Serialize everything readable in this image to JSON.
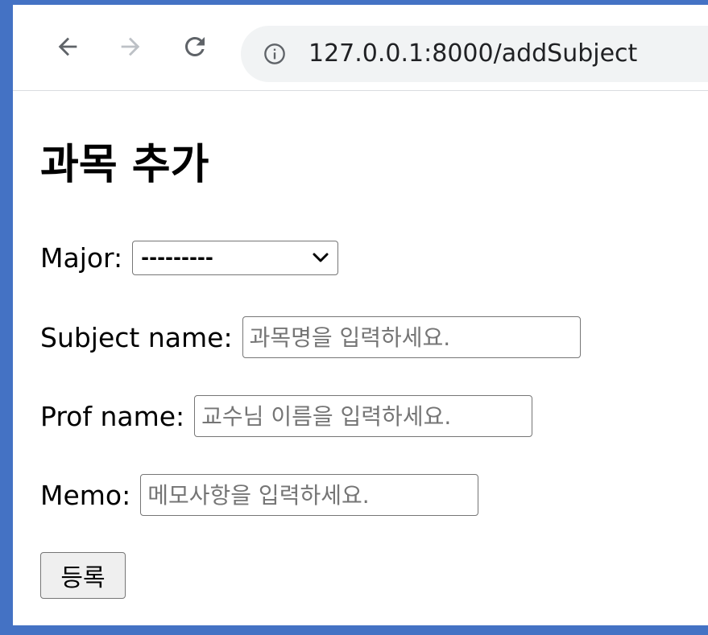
{
  "browser": {
    "url": "127.0.0.1:8000/addSubject",
    "icons": {
      "back": "arrow-left-icon",
      "forward": "arrow-right-icon",
      "reload": "reload-icon",
      "site_info": "info-icon"
    }
  },
  "page": {
    "title": "과목 추가",
    "form": {
      "major": {
        "label": "Major:",
        "selected": "---------"
      },
      "subject_name": {
        "label": "Subject name:",
        "placeholder": "과목명을 입력하세요.",
        "value": ""
      },
      "prof_name": {
        "label": "Prof name:",
        "placeholder": "교수님 이름을 입력하세요.",
        "value": ""
      },
      "memo": {
        "label": "Memo:",
        "placeholder": "메모사항을 입력하세요.",
        "value": ""
      },
      "submit_label": "등록"
    }
  },
  "colors": {
    "frame": "#4472c4",
    "omnibox": "#f1f3f4",
    "icon_active": "#5f6368",
    "icon_disabled": "#bdc1c6"
  }
}
